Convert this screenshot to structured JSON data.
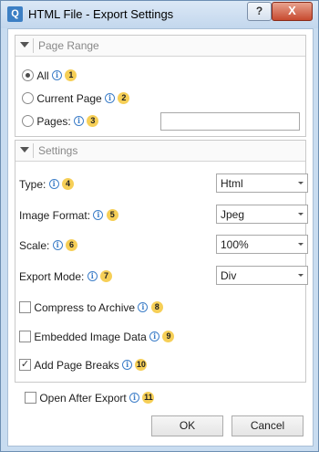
{
  "window": {
    "title": "HTML File - Export Settings",
    "app_icon": "Q",
    "help_symbol": "?",
    "close_symbol": "X"
  },
  "page_range": {
    "title": "Page Range",
    "options": [
      {
        "label": "All",
        "badge": "1",
        "selected": true
      },
      {
        "label": "Current Page",
        "badge": "2",
        "selected": false
      },
      {
        "label": "Pages:",
        "badge": "3",
        "selected": false
      }
    ],
    "pages_value": ""
  },
  "settings": {
    "title": "Settings",
    "fields": [
      {
        "label": "Type:",
        "badge": "4",
        "value": "Html"
      },
      {
        "label": "Image Format:",
        "badge": "5",
        "value": "Jpeg"
      },
      {
        "label": "Scale:",
        "badge": "6",
        "value": "100%"
      },
      {
        "label": "Export Mode:",
        "badge": "7",
        "value": "Div"
      }
    ],
    "checks": [
      {
        "label": "Compress to Archive",
        "badge": "8",
        "checked": false
      },
      {
        "label": "Embedded Image Data",
        "badge": "9",
        "checked": false
      },
      {
        "label": "Add Page Breaks",
        "badge": "10",
        "checked": true
      }
    ]
  },
  "open_after": {
    "label": "Open After Export",
    "badge": "11",
    "checked": false
  },
  "info_glyph": "i",
  "check_glyph": "✓",
  "buttons": {
    "ok": "OK",
    "cancel": "Cancel"
  }
}
